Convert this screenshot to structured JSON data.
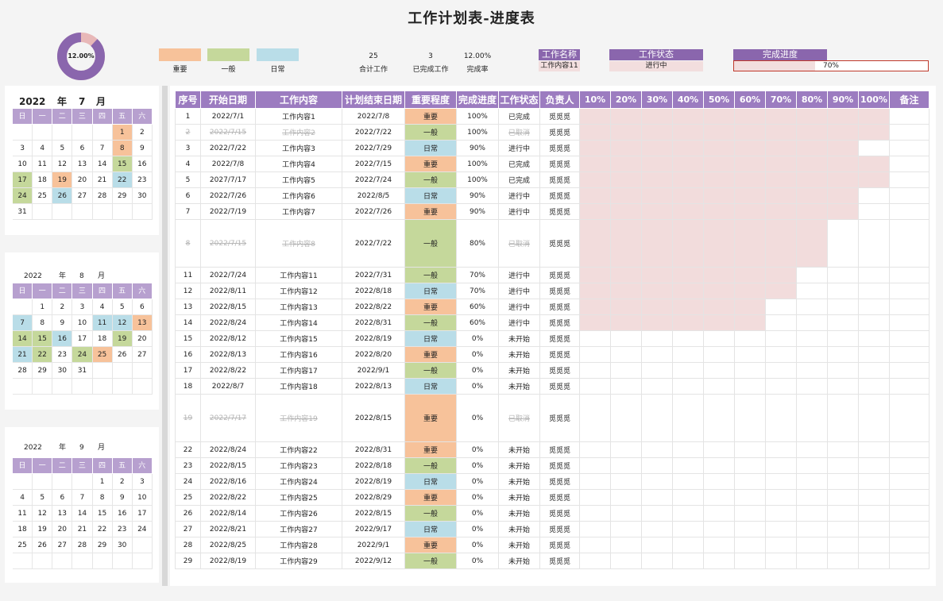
{
  "title": "工作计划表-进度表",
  "donut": {
    "label": "12.00%",
    "value": 0.12,
    "fill": "#8a66ad",
    "rest": "#e8b8b8"
  },
  "legend": [
    {
      "label": "重要",
      "color": "#f7c29a"
    },
    {
      "label": "一般",
      "color": "#c5d89b"
    },
    {
      "label": "日常",
      "color": "#b9dde8"
    }
  ],
  "stats": [
    {
      "value": "25",
      "label": "合计工作"
    },
    {
      "value": "3",
      "label": "已完成工作"
    },
    {
      "value": "12.00%",
      "label": "完成率"
    }
  ],
  "summary": {
    "name_header": "工作名称",
    "name_value": "工作内容11",
    "status_header": "工作状态",
    "status_value": "进行中",
    "progress_header": "完成进度",
    "progress_value": "70%",
    "progress_fraction": 0.7
  },
  "calendars": [
    {
      "year": "2022",
      "year_label": "年",
      "month": "7",
      "month_label": "月",
      "weekdays": [
        "日",
        "一",
        "二",
        "三",
        "四",
        "五",
        "六"
      ],
      "cells": [
        [
          "",
          "",
          "",
          "",
          "",
          "1",
          "2"
        ],
        [
          "3",
          "4",
          "5",
          "6",
          "7",
          "8",
          "9"
        ],
        [
          "10",
          "11",
          "12",
          "13",
          "14",
          "15",
          "16"
        ],
        [
          "17",
          "18",
          "19",
          "20",
          "21",
          "22",
          "23"
        ],
        [
          "24",
          "25",
          "26",
          "27",
          "28",
          "29",
          "30"
        ],
        [
          "31",
          "",
          "",
          "",
          "",
          "",
          ""
        ]
      ],
      "colors": {
        "1": "or",
        "8": "or",
        "15": "gr",
        "17": "gr",
        "19": "or",
        "22": "bl",
        "24": "gr",
        "26": "bl"
      }
    },
    {
      "year": "2022",
      "year_label": "年",
      "month": "8",
      "month_label": "月",
      "weekdays": [
        "日",
        "一",
        "二",
        "三",
        "四",
        "五",
        "六"
      ],
      "cells": [
        [
          "",
          "1",
          "2",
          "3",
          "4",
          "5",
          "6"
        ],
        [
          "7",
          "8",
          "9",
          "10",
          "11",
          "12",
          "13"
        ],
        [
          "14",
          "15",
          "16",
          "17",
          "18",
          "19",
          "20"
        ],
        [
          "21",
          "22",
          "23",
          "24",
          "25",
          "26",
          "27"
        ],
        [
          "28",
          "29",
          "30",
          "31",
          "",
          "",
          ""
        ],
        [
          "",
          "",
          "",
          "",
          "",
          "",
          ""
        ]
      ],
      "colors": {
        "7": "bl",
        "11": "bl",
        "12": "bl",
        "13": "or",
        "14": "gr",
        "15": "gr",
        "16": "bl",
        "19": "gr",
        "21": "bl",
        "22": "gr",
        "24": "gr",
        "25": "or"
      }
    },
    {
      "year": "2022",
      "year_label": "年",
      "month": "9",
      "month_label": "月",
      "weekdays": [
        "日",
        "一",
        "二",
        "三",
        "四",
        "五",
        "六"
      ],
      "cells": [
        [
          "",
          "",
          "",
          "",
          "1",
          "2",
          "3"
        ],
        [
          "4",
          "5",
          "6",
          "7",
          "8",
          "9",
          "10"
        ],
        [
          "11",
          "12",
          "13",
          "14",
          "15",
          "16",
          "17"
        ],
        [
          "18",
          "19",
          "20",
          "21",
          "22",
          "23",
          "24"
        ],
        [
          "25",
          "26",
          "27",
          "28",
          "29",
          "30",
          ""
        ],
        [
          "",
          "",
          "",
          "",
          "",
          "",
          ""
        ]
      ],
      "colors": {}
    }
  ],
  "table": {
    "headers": [
      "序号",
      "开始日期",
      "工作内容",
      "计划结束日期",
      "重要程度",
      "完成进度",
      "工作状态",
      "负责人"
    ],
    "pct_headers": [
      "10%",
      "20%",
      "30%",
      "40%",
      "50%",
      "60%",
      "70%",
      "80%",
      "90%",
      "100%"
    ],
    "note_header": "备注",
    "rows": [
      {
        "no": "1",
        "start": "2022/7/1",
        "task": "工作内容1",
        "end": "2022/7/8",
        "imp": "重要",
        "prog": "100%",
        "status": "已完成",
        "owner": "觅觅觅",
        "bars": 10,
        "h": 20
      },
      {
        "no": "2",
        "start": "2022/7/15",
        "task": "工作内容2",
        "end": "2022/7/22",
        "imp": "一般",
        "prog": "100%",
        "status": "已取消",
        "owner": "觅觅觅",
        "bars": 10,
        "h": 20,
        "cancel": true
      },
      {
        "no": "3",
        "start": "2022/7/22",
        "task": "工作内容3",
        "end": "2022/7/29",
        "imp": "日常",
        "prog": "90%",
        "status": "进行中",
        "owner": "觅觅觅",
        "bars": 9,
        "h": 20
      },
      {
        "no": "4",
        "start": "2022/7/8",
        "task": "工作内容4",
        "end": "2022/7/15",
        "imp": "重要",
        "prog": "100%",
        "status": "已完成",
        "owner": "觅觅觅",
        "bars": 10,
        "h": 20
      },
      {
        "no": "5",
        "start": "2027/7/17",
        "task": "工作内容5",
        "end": "2022/7/24",
        "imp": "一般",
        "prog": "100%",
        "status": "已完成",
        "owner": "觅觅觅",
        "bars": 10,
        "h": 20
      },
      {
        "no": "6",
        "start": "2022/7/26",
        "task": "工作内容6",
        "end": "2022/8/5",
        "imp": "日常",
        "prog": "90%",
        "status": "进行中",
        "owner": "觅觅觅",
        "bars": 9,
        "h": 20
      },
      {
        "no": "7",
        "start": "2022/7/19",
        "task": "工作内容7",
        "end": "2022/7/26",
        "imp": "重要",
        "prog": "90%",
        "status": "进行中",
        "owner": "觅觅觅",
        "bars": 9,
        "h": 20
      },
      {
        "no": "8",
        "start": "2022/7/15",
        "task": "工作内容8",
        "end": "2022/7/22",
        "imp": "一般",
        "prog": "80%",
        "status": "已取消",
        "owner": "觅觅觅",
        "bars": 8,
        "h": 60,
        "cancel": true
      },
      {
        "no": "11",
        "start": "2022/7/24",
        "task": "工作内容11",
        "end": "2022/7/31",
        "imp": "一般",
        "prog": "70%",
        "status": "进行中",
        "owner": "觅觅觅",
        "bars": 7,
        "h": 20
      },
      {
        "no": "12",
        "start": "2022/8/11",
        "task": "工作内容12",
        "end": "2022/8/18",
        "imp": "日常",
        "prog": "70%",
        "status": "进行中",
        "owner": "觅觅觅",
        "bars": 7,
        "h": 20
      },
      {
        "no": "13",
        "start": "2022/8/15",
        "task": "工作内容13",
        "end": "2022/8/22",
        "imp": "重要",
        "prog": "60%",
        "status": "进行中",
        "owner": "觅觅觅",
        "bars": 6,
        "h": 20
      },
      {
        "no": "14",
        "start": "2022/8/24",
        "task": "工作内容14",
        "end": "2022/8/31",
        "imp": "一般",
        "prog": "60%",
        "status": "进行中",
        "owner": "觅觅觅",
        "bars": 6,
        "h": 20
      },
      {
        "no": "15",
        "start": "2022/8/12",
        "task": "工作内容15",
        "end": "2022/8/19",
        "imp": "日常",
        "prog": "0%",
        "status": "未开始",
        "owner": "觅觅觅",
        "bars": 0,
        "h": 20
      },
      {
        "no": "16",
        "start": "2022/8/13",
        "task": "工作内容16",
        "end": "2022/8/20",
        "imp": "重要",
        "prog": "0%",
        "status": "未开始",
        "owner": "觅觅觅",
        "bars": 0,
        "h": 20
      },
      {
        "no": "17",
        "start": "2022/8/22",
        "task": "工作内容17",
        "end": "2022/9/1",
        "imp": "一般",
        "prog": "0%",
        "status": "未开始",
        "owner": "觅觅觅",
        "bars": 0,
        "h": 20
      },
      {
        "no": "18",
        "start": "2022/8/7",
        "task": "工作内容18",
        "end": "2022/8/13",
        "imp": "日常",
        "prog": "0%",
        "status": "未开始",
        "owner": "觅觅觅",
        "bars": 0,
        "h": 20
      },
      {
        "no": "19",
        "start": "2022/7/17",
        "task": "工作内容19",
        "end": "2022/8/15",
        "imp": "重要",
        "prog": "0%",
        "status": "已取消",
        "owner": "觅觅觅",
        "bars": 0,
        "h": 60,
        "cancel": true
      },
      {
        "no": "22",
        "start": "2022/8/24",
        "task": "工作内容22",
        "end": "2022/8/31",
        "imp": "重要",
        "prog": "0%",
        "status": "未开始",
        "owner": "觅觅觅",
        "bars": 0,
        "h": 20
      },
      {
        "no": "23",
        "start": "2022/8/15",
        "task": "工作内容23",
        "end": "2022/8/18",
        "imp": "一般",
        "prog": "0%",
        "status": "未开始",
        "owner": "觅觅觅",
        "bars": 0,
        "h": 20
      },
      {
        "no": "24",
        "start": "2022/8/16",
        "task": "工作内容24",
        "end": "2022/8/19",
        "imp": "日常",
        "prog": "0%",
        "status": "未开始",
        "owner": "觅觅觅",
        "bars": 0,
        "h": 20
      },
      {
        "no": "25",
        "start": "2022/8/22",
        "task": "工作内容25",
        "end": "2022/8/29",
        "imp": "重要",
        "prog": "0%",
        "status": "未开始",
        "owner": "觅觅觅",
        "bars": 0,
        "h": 20
      },
      {
        "no": "26",
        "start": "2022/8/14",
        "task": "工作内容26",
        "end": "2022/8/15",
        "imp": "一般",
        "prog": "0%",
        "status": "未开始",
        "owner": "觅觅觅",
        "bars": 0,
        "h": 20
      },
      {
        "no": "27",
        "start": "2022/8/21",
        "task": "工作内容27",
        "end": "2022/9/17",
        "imp": "日常",
        "prog": "0%",
        "status": "未开始",
        "owner": "觅觅觅",
        "bars": 0,
        "h": 20
      },
      {
        "no": "28",
        "start": "2022/8/25",
        "task": "工作内容28",
        "end": "2022/9/1",
        "imp": "重要",
        "prog": "0%",
        "status": "未开始",
        "owner": "觅觅觅",
        "bars": 0,
        "h": 20
      },
      {
        "no": "29",
        "start": "2022/8/19",
        "task": "工作内容29",
        "end": "2022/9/12",
        "imp": "一般",
        "prog": "0%",
        "status": "未开始",
        "owner": "觅觅觅",
        "bars": 0,
        "h": 20
      }
    ]
  }
}
